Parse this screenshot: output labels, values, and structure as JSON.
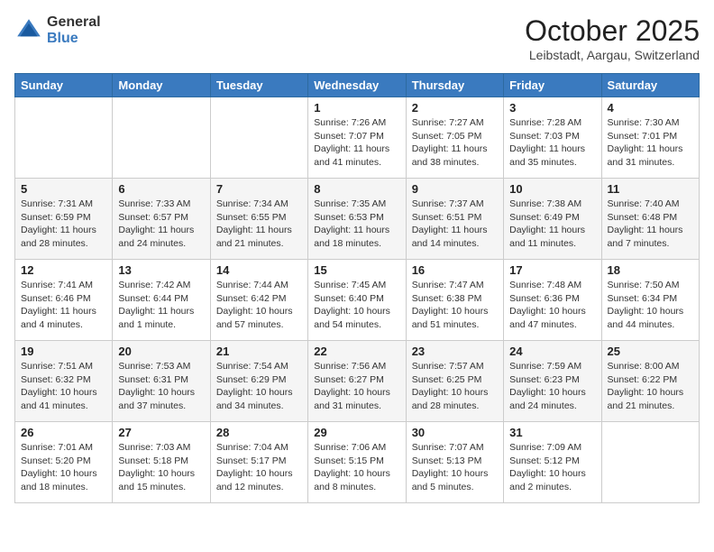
{
  "header": {
    "logo_general": "General",
    "logo_blue": "Blue",
    "month_title": "October 2025",
    "location": "Leibstadt, Aargau, Switzerland"
  },
  "days_of_week": [
    "Sunday",
    "Monday",
    "Tuesday",
    "Wednesday",
    "Thursday",
    "Friday",
    "Saturday"
  ],
  "weeks": [
    [
      {
        "day": "",
        "info": ""
      },
      {
        "day": "",
        "info": ""
      },
      {
        "day": "",
        "info": ""
      },
      {
        "day": "1",
        "info": "Sunrise: 7:26 AM\nSunset: 7:07 PM\nDaylight: 11 hours\nand 41 minutes."
      },
      {
        "day": "2",
        "info": "Sunrise: 7:27 AM\nSunset: 7:05 PM\nDaylight: 11 hours\nand 38 minutes."
      },
      {
        "day": "3",
        "info": "Sunrise: 7:28 AM\nSunset: 7:03 PM\nDaylight: 11 hours\nand 35 minutes."
      },
      {
        "day": "4",
        "info": "Sunrise: 7:30 AM\nSunset: 7:01 PM\nDaylight: 11 hours\nand 31 minutes."
      }
    ],
    [
      {
        "day": "5",
        "info": "Sunrise: 7:31 AM\nSunset: 6:59 PM\nDaylight: 11 hours\nand 28 minutes."
      },
      {
        "day": "6",
        "info": "Sunrise: 7:33 AM\nSunset: 6:57 PM\nDaylight: 11 hours\nand 24 minutes."
      },
      {
        "day": "7",
        "info": "Sunrise: 7:34 AM\nSunset: 6:55 PM\nDaylight: 11 hours\nand 21 minutes."
      },
      {
        "day": "8",
        "info": "Sunrise: 7:35 AM\nSunset: 6:53 PM\nDaylight: 11 hours\nand 18 minutes."
      },
      {
        "day": "9",
        "info": "Sunrise: 7:37 AM\nSunset: 6:51 PM\nDaylight: 11 hours\nand 14 minutes."
      },
      {
        "day": "10",
        "info": "Sunrise: 7:38 AM\nSunset: 6:49 PM\nDaylight: 11 hours\nand 11 minutes."
      },
      {
        "day": "11",
        "info": "Sunrise: 7:40 AM\nSunset: 6:48 PM\nDaylight: 11 hours\nand 7 minutes."
      }
    ],
    [
      {
        "day": "12",
        "info": "Sunrise: 7:41 AM\nSunset: 6:46 PM\nDaylight: 11 hours\nand 4 minutes."
      },
      {
        "day": "13",
        "info": "Sunrise: 7:42 AM\nSunset: 6:44 PM\nDaylight: 11 hours\nand 1 minute."
      },
      {
        "day": "14",
        "info": "Sunrise: 7:44 AM\nSunset: 6:42 PM\nDaylight: 10 hours\nand 57 minutes."
      },
      {
        "day": "15",
        "info": "Sunrise: 7:45 AM\nSunset: 6:40 PM\nDaylight: 10 hours\nand 54 minutes."
      },
      {
        "day": "16",
        "info": "Sunrise: 7:47 AM\nSunset: 6:38 PM\nDaylight: 10 hours\nand 51 minutes."
      },
      {
        "day": "17",
        "info": "Sunrise: 7:48 AM\nSunset: 6:36 PM\nDaylight: 10 hours\nand 47 minutes."
      },
      {
        "day": "18",
        "info": "Sunrise: 7:50 AM\nSunset: 6:34 PM\nDaylight: 10 hours\nand 44 minutes."
      }
    ],
    [
      {
        "day": "19",
        "info": "Sunrise: 7:51 AM\nSunset: 6:32 PM\nDaylight: 10 hours\nand 41 minutes."
      },
      {
        "day": "20",
        "info": "Sunrise: 7:53 AM\nSunset: 6:31 PM\nDaylight: 10 hours\nand 37 minutes."
      },
      {
        "day": "21",
        "info": "Sunrise: 7:54 AM\nSunset: 6:29 PM\nDaylight: 10 hours\nand 34 minutes."
      },
      {
        "day": "22",
        "info": "Sunrise: 7:56 AM\nSunset: 6:27 PM\nDaylight: 10 hours\nand 31 minutes."
      },
      {
        "day": "23",
        "info": "Sunrise: 7:57 AM\nSunset: 6:25 PM\nDaylight: 10 hours\nand 28 minutes."
      },
      {
        "day": "24",
        "info": "Sunrise: 7:59 AM\nSunset: 6:23 PM\nDaylight: 10 hours\nand 24 minutes."
      },
      {
        "day": "25",
        "info": "Sunrise: 8:00 AM\nSunset: 6:22 PM\nDaylight: 10 hours\nand 21 minutes."
      }
    ],
    [
      {
        "day": "26",
        "info": "Sunrise: 7:01 AM\nSunset: 5:20 PM\nDaylight: 10 hours\nand 18 minutes."
      },
      {
        "day": "27",
        "info": "Sunrise: 7:03 AM\nSunset: 5:18 PM\nDaylight: 10 hours\nand 15 minutes."
      },
      {
        "day": "28",
        "info": "Sunrise: 7:04 AM\nSunset: 5:17 PM\nDaylight: 10 hours\nand 12 minutes."
      },
      {
        "day": "29",
        "info": "Sunrise: 7:06 AM\nSunset: 5:15 PM\nDaylight: 10 hours\nand 8 minutes."
      },
      {
        "day": "30",
        "info": "Sunrise: 7:07 AM\nSunset: 5:13 PM\nDaylight: 10 hours\nand 5 minutes."
      },
      {
        "day": "31",
        "info": "Sunrise: 7:09 AM\nSunset: 5:12 PM\nDaylight: 10 hours\nand 2 minutes."
      },
      {
        "day": "",
        "info": ""
      }
    ]
  ]
}
